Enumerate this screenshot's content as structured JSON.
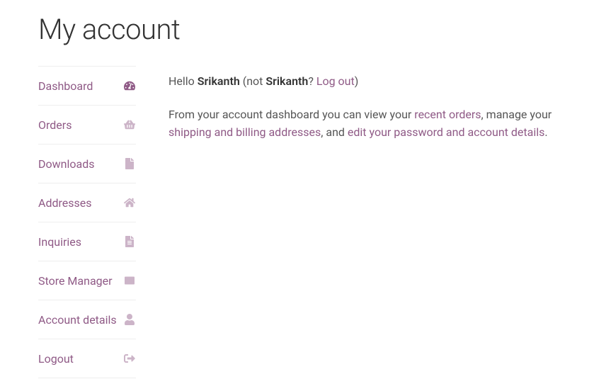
{
  "page": {
    "title": "My account"
  },
  "sidebar": {
    "items": [
      {
        "label": "Dashboard"
      },
      {
        "label": "Orders"
      },
      {
        "label": "Downloads"
      },
      {
        "label": "Addresses"
      },
      {
        "label": "Inquiries"
      },
      {
        "label": "Store Manager"
      },
      {
        "label": "Account details"
      },
      {
        "label": "Logout"
      }
    ]
  },
  "greeting": {
    "hello": "Hello ",
    "name": "Srikanth",
    "not_prefix": " (not ",
    "not_name": "Srikanth",
    "question": "? ",
    "logout": "Log out",
    "close": ")"
  },
  "intro": {
    "p1": "From your account dashboard you can view your ",
    "link_orders": "recent orders",
    "p2": ", manage your ",
    "link_addresses": "shipping and billing addresses",
    "p3": ", and ",
    "link_account": "edit your password and account details",
    "p4": "."
  }
}
